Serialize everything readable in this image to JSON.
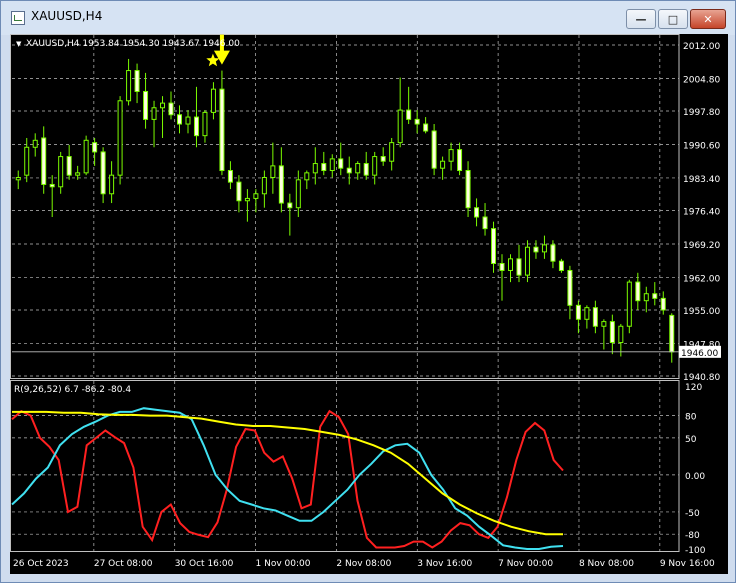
{
  "window": {
    "title": "XAUUSD,H4",
    "buttons": {
      "minimize": "minimize-icon",
      "maximize": "maximize-icon",
      "close": "close-icon"
    }
  },
  "price_panel": {
    "info": "XAUUSD,H4  1953.84 1954.30 1943.67 1946.00",
    "current_price_label": "1946.00",
    "level_label": "1947.80",
    "y_ticks": [
      "2012.00",
      "2004.80",
      "1997.80",
      "1990.60",
      "1983.40",
      "1976.40",
      "1969.20",
      "1962.00",
      "1955.00",
      "1947.80",
      "1940.80"
    ]
  },
  "indicator_panel": {
    "info": "R(9,26,52) 6.7 -86.2 -80.4",
    "y_ticks": [
      "120",
      "80",
      "50",
      "0.00",
      "-50",
      "-80",
      "-100"
    ]
  },
  "x_axis": {
    "ticks": [
      "26 Oct 2023",
      "27 Oct 08:00",
      "30 Oct 16:00",
      "1 Nov 00:00",
      "2 Nov 08:00",
      "3 Nov 16:00",
      "7 Nov 00:00",
      "8 Nov 08:00",
      "9 Nov 16:00"
    ]
  },
  "colors": {
    "background": "#000000",
    "grid": "#c0c0c0",
    "candle": "#7cfc00",
    "candle_bull_body": "#000000",
    "candle_bear_body": "#ffffe0",
    "arrow": "#ffff00",
    "line_red": "#ff2020",
    "line_cyan": "#40e0f0",
    "line_yellow": "#ffff00",
    "text": "#ffffff"
  },
  "chart_data": [
    {
      "type": "candlestick",
      "title": "XAUUSD,H4",
      "ylim": [
        1940.8,
        2012.0
      ],
      "candles": [
        [
          1983.0,
          1985.0,
          1981.0,
          1983.5
        ],
        [
          1984.0,
          1992.0,
          1982.5,
          1990.0
        ],
        [
          1990.0,
          1993.0,
          1988.0,
          1991.5
        ],
        [
          1992.0,
          1994.5,
          1980.0,
          1982.0
        ],
        [
          1982.0,
          1984.0,
          1975.0,
          1981.5
        ],
        [
          1981.5,
          1989.0,
          1980.0,
          1988.0
        ],
        [
          1988.0,
          1990.5,
          1983.0,
          1984.0
        ],
        [
          1984.0,
          1986.0,
          1983.0,
          1984.5
        ],
        [
          1984.5,
          1992.5,
          1984.0,
          1991.5
        ],
        [
          1991.0,
          1992.0,
          1986.0,
          1989.0
        ],
        [
          1989.0,
          1990.0,
          1978.0,
          1980.0
        ],
        [
          1980.0,
          1987.0,
          1978.0,
          1984.0
        ],
        [
          1984.0,
          2001.0,
          1982.0,
          2000.0
        ],
        [
          2000.0,
          2009.0,
          1999.0,
          2006.5
        ],
        [
          2006.5,
          2008.0,
          1999.5,
          2002.0
        ],
        [
          2002.0,
          2006.0,
          1994.0,
          1996.0
        ],
        [
          1996.0,
          2000.0,
          1990.0,
          1998.5
        ],
        [
          1998.5,
          2001.0,
          1992.0,
          1999.5
        ],
        [
          1999.5,
          2002.0,
          1996.0,
          1997.0
        ],
        [
          1997.0,
          1999.0,
          1993.0,
          1995.0
        ],
        [
          1995.0,
          1998.0,
          1993.0,
          1996.5
        ],
        [
          1996.5,
          2003.0,
          1990.0,
          1992.5
        ],
        [
          1992.5,
          1998.0,
          1991.0,
          1997.5
        ],
        [
          1997.5,
          2004.0,
          1996.0,
          2002.5
        ],
        [
          2002.5,
          2006.5,
          1984.0,
          1985.0
        ],
        [
          1985.0,
          1987.0,
          1981.0,
          1982.5
        ],
        [
          1982.5,
          1984.0,
          1976.0,
          1978.5
        ],
        [
          1978.5,
          1981.0,
          1974.0,
          1979.0
        ],
        [
          1979.0,
          1981.0,
          1976.0,
          1980.0
        ],
        [
          1980.0,
          1985.0,
          1977.0,
          1983.5
        ],
        [
          1983.5,
          1991.0,
          1980.0,
          1986.0
        ],
        [
          1986.0,
          1990.0,
          1976.0,
          1978.0
        ],
        [
          1978.0,
          1980.0,
          1971.0,
          1977.0
        ],
        [
          1977.0,
          1985.0,
          1975.0,
          1983.0
        ],
        [
          1983.0,
          1985.0,
          1981.0,
          1984.5
        ],
        [
          1984.5,
          1990.0,
          1982.0,
          1986.5
        ],
        [
          1986.5,
          1989.0,
          1984.0,
          1985.0
        ],
        [
          1985.0,
          1988.5,
          1983.5,
          1987.5
        ],
        [
          1987.5,
          1991.0,
          1984.0,
          1985.5
        ],
        [
          1985.5,
          1988.0,
          1982.0,
          1984.5
        ],
        [
          1984.5,
          1987.0,
          1983.0,
          1986.5
        ],
        [
          1986.5,
          1989.0,
          1983.0,
          1984.0
        ],
        [
          1984.0,
          1989.0,
          1982.0,
          1988.0
        ],
        [
          1988.0,
          1990.0,
          1986.0,
          1987.0
        ],
        [
          1987.0,
          1992.0,
          1985.0,
          1991.0
        ],
        [
          1991.0,
          2005.0,
          1990.0,
          1998.0
        ],
        [
          1998.0,
          2003.0,
          1995.0,
          1996.0
        ],
        [
          1996.0,
          1998.0,
          1993.0,
          1995.0
        ],
        [
          1995.0,
          1996.5,
          1993.0,
          1993.5
        ],
        [
          1993.5,
          1995.0,
          1984.0,
          1985.5
        ],
        [
          1985.5,
          1988.0,
          1983.0,
          1987.0
        ],
        [
          1987.0,
          1991.0,
          1985.0,
          1989.5
        ],
        [
          1989.5,
          1991.0,
          1984.0,
          1985.0
        ],
        [
          1985.0,
          1987.0,
          1975.0,
          1977.0
        ],
        [
          1977.0,
          1979.0,
          1973.0,
          1975.0
        ],
        [
          1975.0,
          1978.0,
          1971.0,
          1972.5
        ],
        [
          1972.5,
          1974.0,
          1963.0,
          1965.0
        ],
        [
          1965.0,
          1967.0,
          1957.0,
          1963.5
        ],
        [
          1963.5,
          1967.0,
          1961.0,
          1966.0
        ],
        [
          1966.0,
          1969.0,
          1961.0,
          1962.5
        ],
        [
          1962.5,
          1970.0,
          1961.0,
          1968.5
        ],
        [
          1968.5,
          1970.0,
          1966.0,
          1967.5
        ],
        [
          1967.5,
          1971.0,
          1966.0,
          1969.0
        ],
        [
          1969.0,
          1970.0,
          1964.0,
          1965.5
        ],
        [
          1965.5,
          1966.0,
          1963.0,
          1963.5
        ],
        [
          1963.5,
          1964.5,
          1953.0,
          1956.0
        ],
        [
          1956.0,
          1957.0,
          1950.0,
          1953.0
        ],
        [
          1953.0,
          1956.0,
          1951.0,
          1955.5
        ],
        [
          1955.5,
          1957.0,
          1950.0,
          1951.5
        ],
        [
          1951.5,
          1953.0,
          1946.5,
          1952.5
        ],
        [
          1952.5,
          1954.0,
          1945.5,
          1948.0
        ],
        [
          1948.0,
          1952.0,
          1945.0,
          1951.5
        ],
        [
          1951.5,
          1961.5,
          1950.0,
          1961.0
        ],
        [
          1961.0,
          1963.0,
          1955.0,
          1957.0
        ],
        [
          1957.0,
          1960.0,
          1954.5,
          1958.5
        ],
        [
          1958.5,
          1961.0,
          1956.0,
          1957.5
        ],
        [
          1957.5,
          1959.0,
          1954.0,
          1955.0
        ],
        [
          1953.84,
          1954.3,
          1943.67,
          1946.0
        ]
      ]
    },
    {
      "type": "line",
      "title": "R(9,26,52)",
      "ylim": [
        -100,
        120
      ],
      "series": [
        {
          "values": [
            75,
            86,
            80,
            50,
            38,
            20,
            -50,
            -43,
            40,
            50,
            60,
            51,
            43,
            10,
            -70,
            -88,
            -50,
            -40,
            -65,
            -77,
            -81,
            -84,
            -64,
            -20,
            38,
            62,
            60,
            30,
            18,
            25,
            -5,
            -45,
            -40,
            65,
            86,
            78,
            55,
            -35,
            -85,
            -98,
            -98,
            -98,
            -96,
            -90,
            -90,
            -98,
            -90,
            -75,
            -65,
            -68,
            -80,
            -85,
            -70,
            -30,
            20,
            58,
            70,
            60,
            20,
            6
          ]
        },
        {
          "values": [
            -40,
            -25,
            -5,
            10,
            40,
            55,
            65,
            72,
            80,
            85,
            85,
            90,
            88,
            86,
            84,
            75,
            40,
            0,
            -20,
            -35,
            -40,
            -45,
            -48,
            -55,
            -62,
            -62,
            -50,
            -35,
            -20,
            0,
            15,
            32,
            40,
            42,
            30,
            0,
            -20,
            -45,
            -55,
            -70,
            -82,
            -95,
            -98,
            -100,
            -100,
            -97,
            -96
          ]
        },
        {
          "values": [
            85,
            85,
            85,
            84,
            84,
            82,
            81,
            81,
            80,
            80,
            78,
            76,
            72,
            68,
            66,
            66,
            64,
            62,
            58,
            54,
            48,
            40,
            30,
            15,
            -5,
            -25,
            -40,
            -52,
            -62,
            -70,
            -76,
            -80,
            -80
          ]
        }
      ]
    }
  ]
}
